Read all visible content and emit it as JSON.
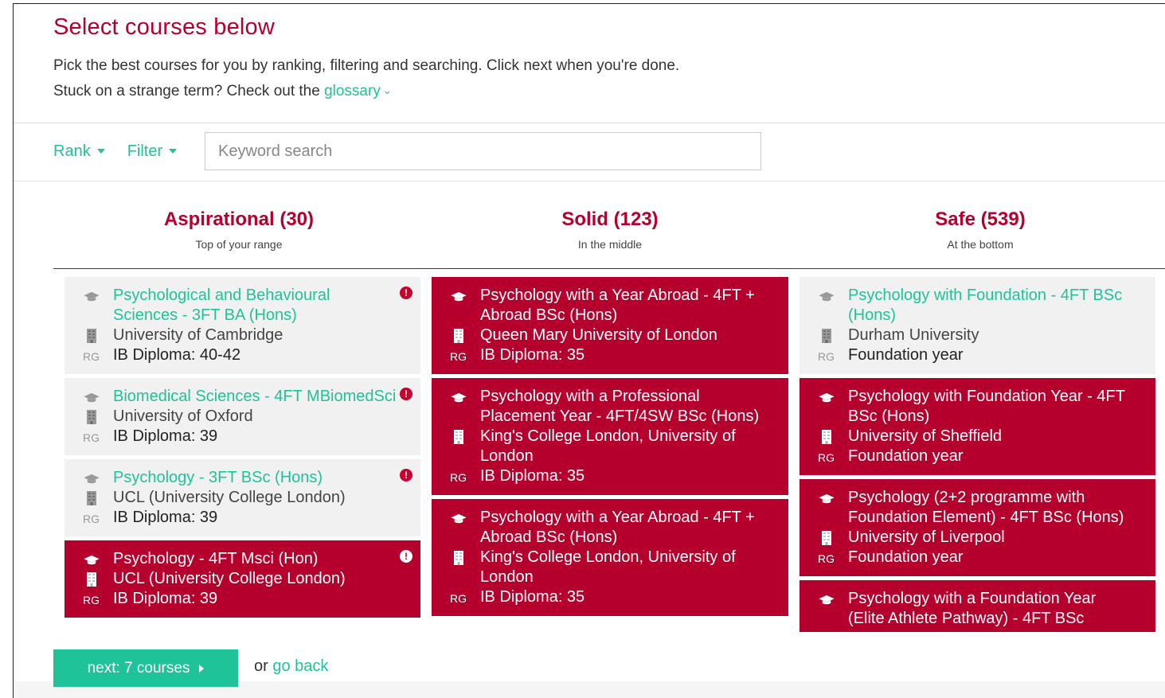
{
  "header": {
    "title": "Select courses below",
    "line1": "Pick the best courses for you by ranking, filtering and searching. Click next when you're done.",
    "line2_prefix": "Stuck on a strange term? Check out the",
    "glossary_link": "glossary"
  },
  "toolbar": {
    "rank_label": "Rank",
    "filter_label": "Filter",
    "search_placeholder": "Keyword search"
  },
  "columns": [
    {
      "heading": "Aspirational (30)",
      "subheading": "Top of your range",
      "cards": [
        {
          "selected": false,
          "alert": true,
          "course": "Psychological and Behavioural Sciences - 3FT BA (Hons)",
          "university": "University of Cambridge",
          "requirement": "IB Diploma: 40-42",
          "tag": "RG"
        },
        {
          "selected": false,
          "alert": true,
          "course": "Biomedical Sciences - 4FT MBiomedSci",
          "university": "University of Oxford",
          "requirement": "IB Diploma: 39",
          "tag": "RG"
        },
        {
          "selected": false,
          "alert": true,
          "course": "Psychology - 3FT BSc (Hons)",
          "university": "UCL (University College London)",
          "requirement": "IB Diploma: 39",
          "tag": "RG"
        },
        {
          "selected": true,
          "alert": true,
          "course": "Psychology - 4FT Msci (Hon)",
          "university": "UCL (University College London)",
          "requirement": "IB Diploma: 39",
          "tag": "RG"
        }
      ]
    },
    {
      "heading": "Solid (123)",
      "subheading": "In the middle",
      "cards": [
        {
          "selected": true,
          "alert": false,
          "course": "Psychology with a Year Abroad - 4FT + Abroad BSc (Hons)",
          "university": "Queen Mary University of London",
          "requirement": "IB Diploma: 35",
          "tag": "RG"
        },
        {
          "selected": true,
          "alert": false,
          "course": "Psychology with a Professional Placement Year - 4FT/4SW BSc (Hons)",
          "university": "King's College London, University of London",
          "requirement": "IB Diploma: 35",
          "tag": "RG"
        },
        {
          "selected": true,
          "alert": false,
          "course": "Psychology with a Year Abroad - 4FT + Abroad BSc (Hons)",
          "university": "King's College London, University of London",
          "requirement": "IB Diploma: 35",
          "tag": "RG"
        }
      ]
    },
    {
      "heading": "Safe (539)",
      "subheading": "At the bottom",
      "cards": [
        {
          "selected": false,
          "alert": false,
          "course": "Psychology with Foundation - 4FT BSc (Hons)",
          "university": "Durham University",
          "requirement": "Foundation year",
          "tag": "RG"
        },
        {
          "selected": true,
          "alert": false,
          "course": "Psychology with Foundation Year - 4FT BSc (Hons)",
          "university": "University of Sheffield",
          "requirement": "Foundation year",
          "tag": "RG"
        },
        {
          "selected": true,
          "alert": false,
          "course": "Psychology (2+2 programme with Foundation Element) - 4FT BSc (Hons)",
          "university": "University of Liverpool",
          "requirement": "Foundation year",
          "tag": "RG"
        },
        {
          "selected": true,
          "alert": false,
          "course": "Psychology with a Foundation Year (Elite Athlete Pathway) - 4FT BSc",
          "university": "",
          "requirement": "",
          "tag": ""
        }
      ]
    }
  ],
  "footer": {
    "next_label": "next: 7 courses",
    "or_text": "or",
    "go_back_label": "go back"
  },
  "colors": {
    "brand_red": "#b5002e",
    "accent_green": "#1ec39a",
    "card_grey": "#f1f1f1"
  },
  "icons": {
    "course": "graduation-cap-icon",
    "university": "building-icon",
    "alert": "exclamation-icon"
  }
}
